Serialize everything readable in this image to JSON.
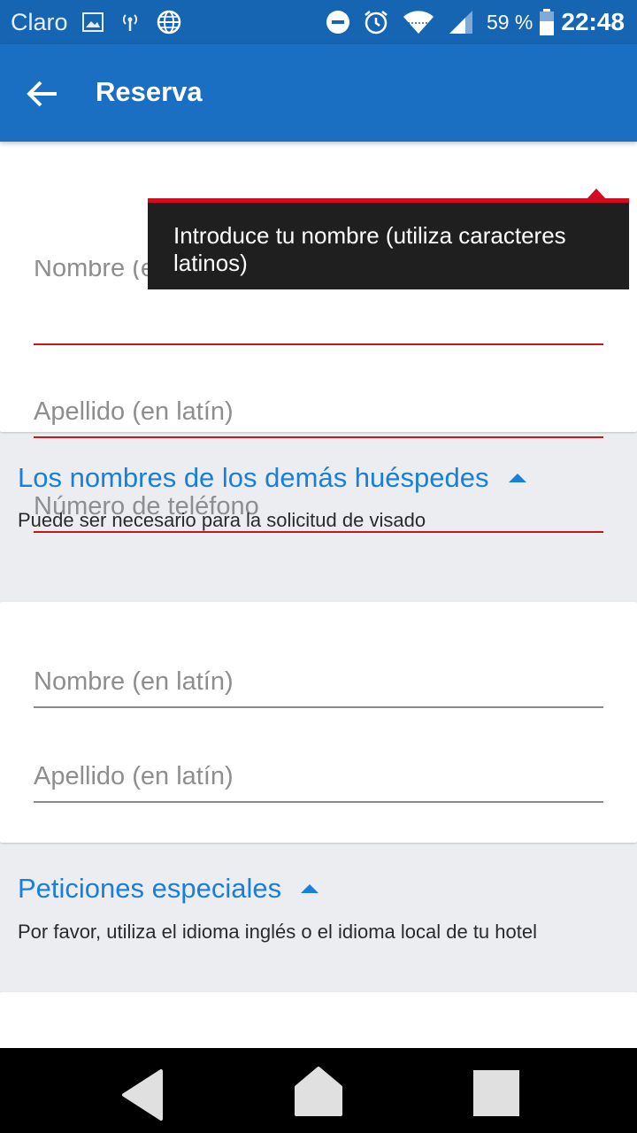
{
  "status_bar": {
    "carrier": "Claro",
    "battery_percent": "59 %",
    "time": "22:48",
    "icons": [
      "image-icon",
      "hotspot-icon",
      "globe-icon",
      "do-not-disturb-icon",
      "alarm-icon",
      "wifi-icon",
      "signal-icon",
      "battery-icon"
    ]
  },
  "app_bar": {
    "title": "Reserva",
    "back_icon": "arrow-left-icon"
  },
  "main_guest": {
    "first_name_placeholder": "Nombre (en latín)",
    "last_name_placeholder": "Apellido (en latín)",
    "phone_placeholder": "Número de teléfono",
    "tooltip": "Introduce tu nombre (utiliza caracteres latinos)",
    "error_color": "#c8161d"
  },
  "other_guests": {
    "title": "Los nombres de los demás huéspedes",
    "subtitle": "Puede ser necesario para la solicitud de visado",
    "first_name_placeholder": "Nombre (en latín)",
    "last_name_placeholder": "Apellido (en latín)"
  },
  "special_requests": {
    "title": "Peticiones especiales",
    "subtitle": "Por favor, utiliza el idioma inglés o el idioma local de tu hotel"
  },
  "colors": {
    "status_bar": "#1565b3",
    "app_bar": "#1a6fc2",
    "accent": "#1a7fd9",
    "background": "#ebedf1"
  },
  "nav_bar": {
    "icons": [
      "back-triangle-icon",
      "home-icon",
      "recents-square-icon"
    ]
  }
}
